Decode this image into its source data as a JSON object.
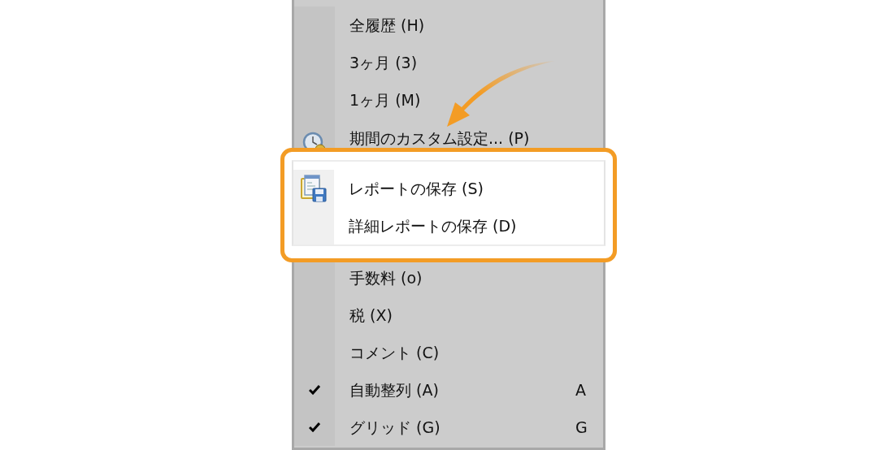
{
  "menu": {
    "sections": [
      {
        "highlighted": false,
        "items": [
          {
            "label": "全履歴 (H)",
            "checked": false,
            "kind": "plain"
          },
          {
            "label": "3ヶ月 (3)",
            "checked": false,
            "kind": "plain"
          },
          {
            "label": "1ヶ月 (M)",
            "checked": false,
            "kind": "plain"
          },
          {
            "label": "期間のカスタム設定... (P)",
            "checked": false,
            "kind": "clock"
          }
        ]
      },
      {
        "highlighted": true,
        "items": [
          {
            "label": "レポートの保存 (S)",
            "checked": false,
            "kind": "save"
          },
          {
            "label": "詳細レポートの保存 (D)",
            "checked": false,
            "kind": "plain"
          }
        ]
      },
      {
        "highlighted": false,
        "items": [
          {
            "label": "手数料 (o)",
            "checked": false,
            "kind": "plain"
          },
          {
            "label": "税 (X)",
            "checked": false,
            "kind": "plain"
          },
          {
            "label": "コメント (C)",
            "checked": false,
            "kind": "plain"
          },
          {
            "label": "自動整列 (A)",
            "checked": true,
            "kind": "plain",
            "shortcut": "A"
          },
          {
            "label": "グリッド (G)",
            "checked": true,
            "kind": "plain",
            "shortcut": "G"
          }
        ]
      }
    ]
  }
}
